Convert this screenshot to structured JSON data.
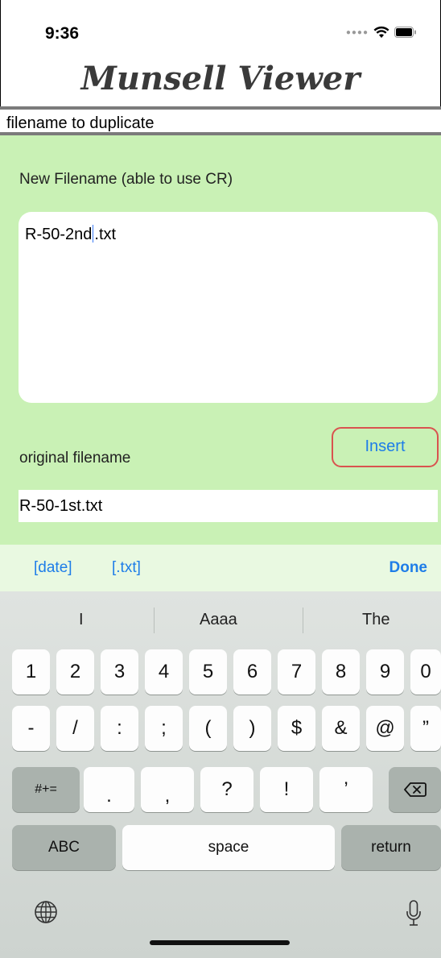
{
  "status_bar": {
    "time": "9:36",
    "icons": [
      "signal-icon",
      "wifi-icon",
      "battery-icon"
    ]
  },
  "header": {
    "title": "Munsell Viewer"
  },
  "sub_bar": {
    "text": "filename to duplicate"
  },
  "panel": {
    "new_filename_label": "New Filename (able to use CR)",
    "new_filename_before_caret": "R-50-2nd",
    "new_filename_after_caret": ".txt",
    "original_label": "original filename",
    "insert_label": "Insert",
    "original_value": "R-50-1st.txt",
    "background": "#c9f1b5"
  },
  "accessory": {
    "date_label": "[date]",
    "txt_label": "[.txt]",
    "done_label": "Done",
    "accent": "#1e7de8"
  },
  "keyboard": {
    "suggestions": [
      "I",
      "Aaaa",
      "The"
    ],
    "row1": [
      "1",
      "2",
      "3",
      "4",
      "5",
      "6",
      "7",
      "8",
      "9",
      "0"
    ],
    "row2": [
      "-",
      "/",
      ":",
      ";",
      "(",
      ")",
      "$",
      "&",
      "@",
      "”"
    ],
    "row3": [
      ".",
      ",",
      "?",
      "!",
      "’"
    ],
    "symbols_toggle": "#+=",
    "abc_label": "ABC",
    "space_label": "space",
    "return_label": "return"
  }
}
